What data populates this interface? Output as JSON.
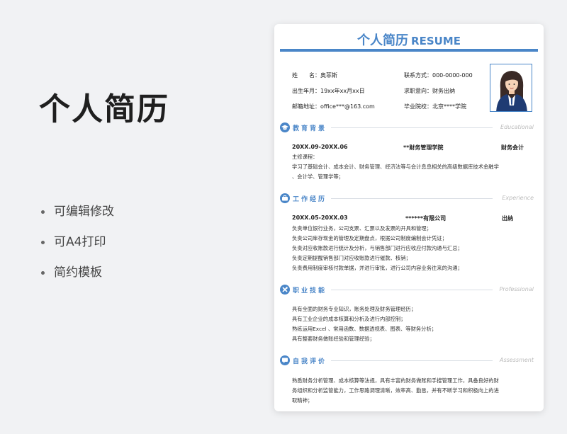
{
  "left": {
    "title": "个人简历",
    "features": [
      "可编辑修改",
      "可A4打印",
      "简约模板"
    ]
  },
  "resume": {
    "title_cn": "个人简历",
    "title_en": "RESUME",
    "accent_color": "#4a86c8",
    "info": {
      "name_label": "姓　　名：",
      "name": "奥菲斯",
      "contact_label": "联系方式：",
      "contact": "000-0000-000",
      "birth_label": "出生年月：",
      "birth": "19xx年xx月xx日",
      "intent_label": "求职意向：",
      "intent": "财务出纳",
      "email_label": "邮箱地址：",
      "email": "office***@163.com",
      "school_label": "毕业院校：",
      "school": "北京****学院"
    },
    "education": {
      "title": "教育背景",
      "en": "Educational",
      "icon": "graduation-cap-icon",
      "date": "20XX.09-20XX.06",
      "school": "**财务管理学院",
      "major": "财务会计",
      "lines": [
        "主修课程：",
        "学习了基础会计、成本会计、财务管理、经济法等与会计息息相关的高级数据库技术金融学",
        "、会计学、管理学等；"
      ]
    },
    "work": {
      "title": "工作经历",
      "en": "Experience",
      "icon": "briefcase-icon",
      "date": "20XX.05-20XX.03",
      "company": "******有限公司",
      "position": "出纳",
      "lines": [
        "负责单位银行业务，公司支票、汇票以及发票的开具和管理；",
        "负责公司库存现金的管理及定期盘点，根据公司制度编制会计凭证；",
        "负责对应收账款进行统计及分析，与销售部门进行应收应付款沟通与汇总；",
        "负责定期提醒销售部门对应收账款进行催款、核销；",
        "负责费用制度审核付款单据，并进行审批，进行公司内容业务往来的沟通；"
      ]
    },
    "skills": {
      "title": "职业技能",
      "en": "Professional",
      "icon": "tools-icon",
      "lines": [
        "具有全面的财务专业知识，账务处理及财务管理经历；",
        "具有工业企业的成本核算和分析及进行内部控制；",
        "熟练运用Excel 、常用函数、数据透视表、图表、等财务分析；",
        "具有整套财务做账经验和管理经验；"
      ]
    },
    "self": {
      "title": "自我评价",
      "en": "Assessment",
      "icon": "chat-icon",
      "lines": [
        "熟悉财务分析管理、成本核算等法规，具有丰富的财务做账和手搜管理工作，具备良好的财",
        "务组织和分析监管能力，工作思路调理清晰，效率高、勤恳，并有不断学习和积极向上的进",
        "取精神；"
      ]
    }
  }
}
